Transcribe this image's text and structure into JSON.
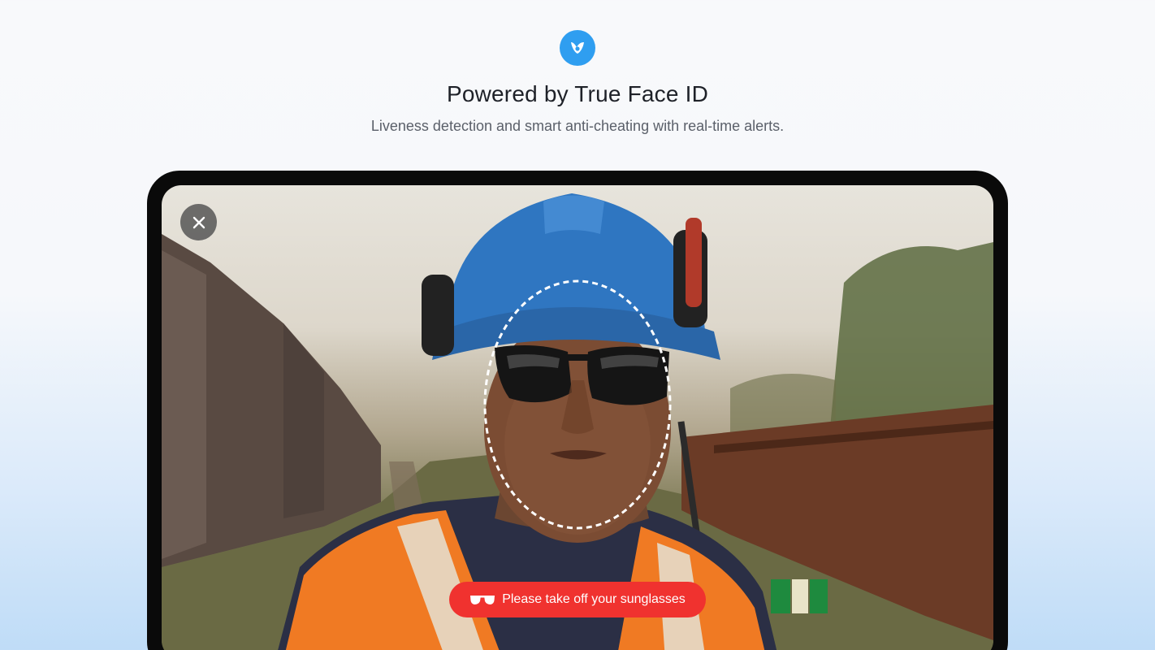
{
  "header": {
    "logo_icon": "true-face-id-logo-icon",
    "title": "Powered by True Face ID",
    "subtitle": "Liveness detection and smart anti-cheating with real-time alerts."
  },
  "camera": {
    "close_icon": "close-icon",
    "face_guide": "dashed-oval-face-guide",
    "alert": {
      "icon": "sunglasses-icon",
      "text": "Please take off your sunglasses",
      "color": "#f0322f"
    }
  },
  "colors": {
    "brand": "#2f9ef0",
    "alert": "#f0322f",
    "device_frame": "#0a0a0a"
  }
}
